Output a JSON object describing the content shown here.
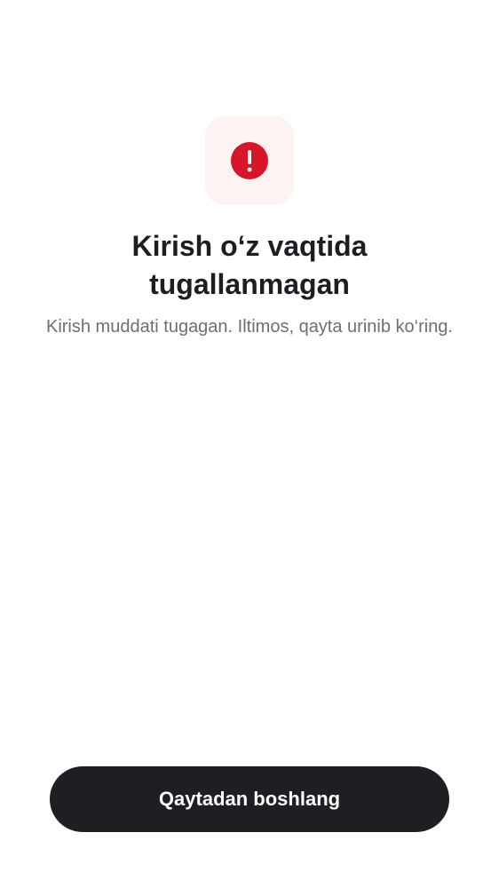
{
  "icon": {
    "name": "alert-circle-icon",
    "color": "#d6172a",
    "tile_color": "#fdf3f2"
  },
  "title": "Kirish o‘z vaqtida tugallanmagan",
  "subtitle": "Kirish muddati tugagan. Iltimos, qayta urinib ko‘ring.",
  "button": {
    "label": "Qaytadan boshlang",
    "color": "#1e1f23"
  }
}
